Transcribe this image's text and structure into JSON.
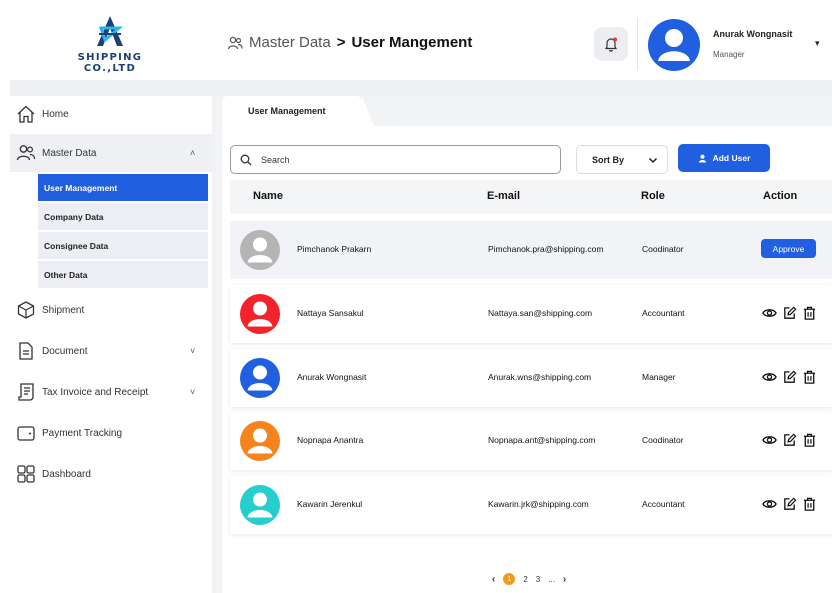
{
  "brand": {
    "name": "SHIPPING CO.,LTD",
    "logo_icon": "shipping-logo-icon",
    "color": "#1c3f7a"
  },
  "breadcrumb": {
    "icon": "users-icon",
    "parent": "Master Data",
    "separator": ">",
    "current": "User Mangement"
  },
  "header": {
    "notification_icon": "bell-icon",
    "user_name": "Anurak Wongnasit",
    "user_role": "Manager",
    "caret": "▾"
  },
  "sidebar": {
    "items": [
      {
        "label": "Home",
        "icon": "home-icon"
      },
      {
        "label": "Master Data",
        "icon": "users-icon",
        "caret": "˄"
      },
      {
        "label": "Shipment",
        "icon": "box-icon"
      },
      {
        "label": "Document",
        "icon": "document-icon",
        "caret": "˅"
      },
      {
        "label": "Tax Invoice and Receipt",
        "icon": "receipt-icon",
        "caret": "˅"
      },
      {
        "label": "Payment Tracking",
        "icon": "wallet-icon"
      },
      {
        "label": "Dashboard",
        "icon": "dashboard-icon"
      }
    ],
    "master_sub": [
      {
        "label": "User Management",
        "active": true
      },
      {
        "label": "Company Data"
      },
      {
        "label": "Consignee Data"
      },
      {
        "label": "Other Data"
      }
    ]
  },
  "main": {
    "tab_label": "User Management",
    "search_placeholder": "Search",
    "sort_label": "Sort By",
    "add_user_label": "Add User",
    "columns": [
      "Name",
      "E-mail",
      "Role",
      "Action"
    ],
    "approve_label": "Approve",
    "users": [
      {
        "name": "Pimchanok Prakarn",
        "email": "Pimchanok.pra@shipping.com",
        "role": "Coodinator",
        "avatar_color": "#b5b5b5",
        "pending": true
      },
      {
        "name": "Nattaya Sansakul",
        "email": "Nattaya.san@shipping.com",
        "role": "Accountant",
        "avatar_color": "#f2232a"
      },
      {
        "name": "Anurak Wongnasit",
        "email": "Anurak.wns@shipping.com",
        "role": "Manager",
        "avatar_color": "#1f5fe0"
      },
      {
        "name": "Nopnapa Anantra",
        "email": "Nopnapa.ant@shipping.com",
        "role": "Coodinator",
        "avatar_color": "#f5841f"
      },
      {
        "name": "Kawarin Jerenkul",
        "email": "Kawarin.jrk@shipping.com",
        "role": "Accountant",
        "avatar_color": "#25cfd0"
      }
    ],
    "row_action_icons": [
      "view-icon",
      "edit-icon",
      "delete-icon"
    ]
  },
  "pagination": {
    "prev": "‹",
    "pages": [
      "1",
      "2",
      "3"
    ],
    "current": "1",
    "ellipsis": "...",
    "next": "›"
  },
  "colors": {
    "accent": "#1f5fe0",
    "page_current": "#f39a1a"
  }
}
